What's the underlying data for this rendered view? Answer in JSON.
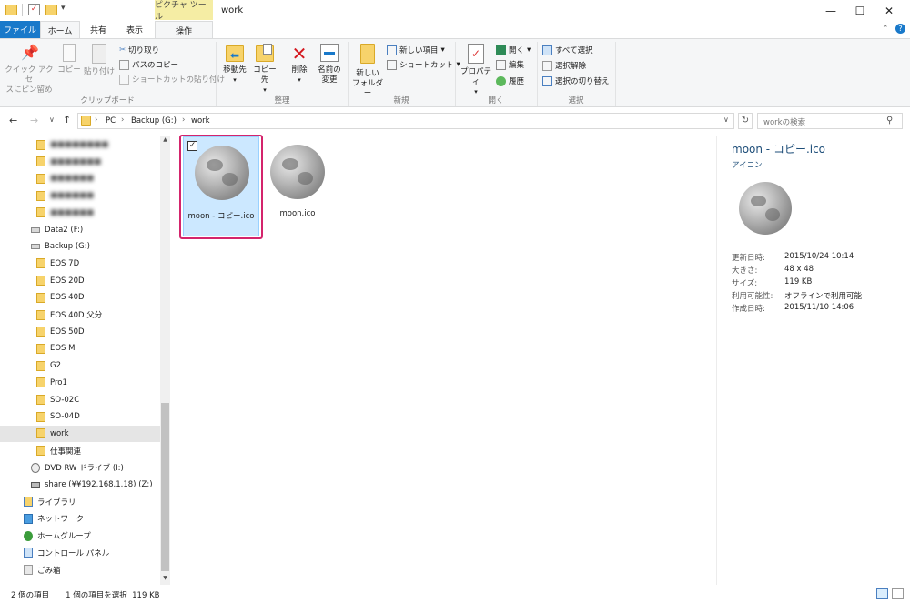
{
  "window": {
    "title": "work",
    "context_tab": "ピクチャ ツール",
    "minimize": "—",
    "maximize": "☐",
    "close": "✕"
  },
  "ribbon_tabs": {
    "file": "ファイル",
    "home": "ホーム",
    "share": "共有",
    "view": "表示",
    "manage": "操作"
  },
  "clipboard": {
    "pin_quick_access": [
      "クイック アクセ",
      "スにピン留め"
    ],
    "copy": "コピー",
    "paste": "貼り付け",
    "cut": "切り取り",
    "copy_path": "パスのコピー",
    "paste_shortcut": "ショートカットの貼り付け",
    "group_label": "クリップボード"
  },
  "organize": {
    "move_to": "移動先",
    "copy_to": "コピー先",
    "delete": "削除",
    "rename": [
      "名前の",
      "変更"
    ],
    "group_label": "整理"
  },
  "new": {
    "new_folder": [
      "新しい",
      "フォルダー"
    ],
    "new_item": "新しい項目",
    "shortcut": "ショートカット",
    "group_label": "新規"
  },
  "open": {
    "properties": "プロパティ",
    "open": "開く",
    "edit": "編集",
    "history": "履歴",
    "group_label": "開く"
  },
  "select": {
    "select_all": "すべて選択",
    "select_none": "選択解除",
    "invert": "選択の切り替え",
    "group_label": "選択"
  },
  "address": {
    "crumbs": [
      "PC",
      "Backup (G:)",
      "work"
    ],
    "search_placeholder": "workの検索"
  },
  "nav": {
    "blurred": [
      "■■■■■■■■",
      "■■■■■■■",
      "■■■■■■",
      "■■■■■■",
      "■■■■■■"
    ],
    "items": [
      {
        "label": "Data2 (F:)",
        "level": 1,
        "icon": "drive"
      },
      {
        "label": "Backup (G:)",
        "level": 1,
        "icon": "drive"
      },
      {
        "label": "EOS 7D",
        "level": 2,
        "icon": "folder"
      },
      {
        "label": "EOS 20D",
        "level": 2,
        "icon": "folder"
      },
      {
        "label": "EOS 40D",
        "level": 2,
        "icon": "folder"
      },
      {
        "label": "EOS 40D 父分",
        "level": 2,
        "icon": "folder"
      },
      {
        "label": "EOS 50D",
        "level": 2,
        "icon": "folder"
      },
      {
        "label": "EOS M",
        "level": 2,
        "icon": "folder"
      },
      {
        "label": "G2",
        "level": 2,
        "icon": "folder"
      },
      {
        "label": "Pro1",
        "level": 2,
        "icon": "folder"
      },
      {
        "label": "SO-02C",
        "level": 2,
        "icon": "folder"
      },
      {
        "label": "SO-04D",
        "level": 2,
        "icon": "folder"
      },
      {
        "label": "work",
        "level": 2,
        "icon": "folder",
        "selected": true
      },
      {
        "label": "仕事関連",
        "level": 2,
        "icon": "folder"
      },
      {
        "label": "DVD RW ドライブ (I:)",
        "level": 1,
        "icon": "dvd"
      },
      {
        "label": "share (¥¥192.168.1.18) (Z:)",
        "level": 1,
        "icon": "network-drive"
      },
      {
        "label": "ライブラリ",
        "level": 0,
        "icon": "library"
      },
      {
        "label": "ネットワーク",
        "level": 0,
        "icon": "network"
      },
      {
        "label": "ホームグループ",
        "level": 0,
        "icon": "homegroup"
      },
      {
        "label": "コントロール パネル",
        "level": 0,
        "icon": "control-panel"
      },
      {
        "label": "ごみ箱",
        "level": 0,
        "icon": "recycle-bin"
      }
    ]
  },
  "files": [
    {
      "name": "moon - コピー.ico",
      "selected": true
    },
    {
      "name": "moon.ico",
      "selected": false
    }
  ],
  "details": {
    "title": "moon - コピー.ico",
    "type": "アイコン",
    "rows": [
      {
        "label": "更新日時:",
        "value": "2015/10/24 10:14"
      },
      {
        "label": "大きさ:",
        "value": "48 x 48"
      },
      {
        "label": "サイズ:",
        "value": "119 KB"
      },
      {
        "label": "利用可能性:",
        "value": "オフラインで利用可能"
      },
      {
        "label": "作成日時:",
        "value": "2015/11/10 14:06"
      }
    ]
  },
  "status": {
    "item_count": "2 個の項目",
    "selection": "1 個の項目を選択  119 KB"
  },
  "colors": {
    "file_tab": "#1979ca",
    "selection_fill": "#cce8ff",
    "highlight_border": "#d4246c",
    "context_tab": "#f5eda4",
    "details_title": "#1e4e79"
  }
}
